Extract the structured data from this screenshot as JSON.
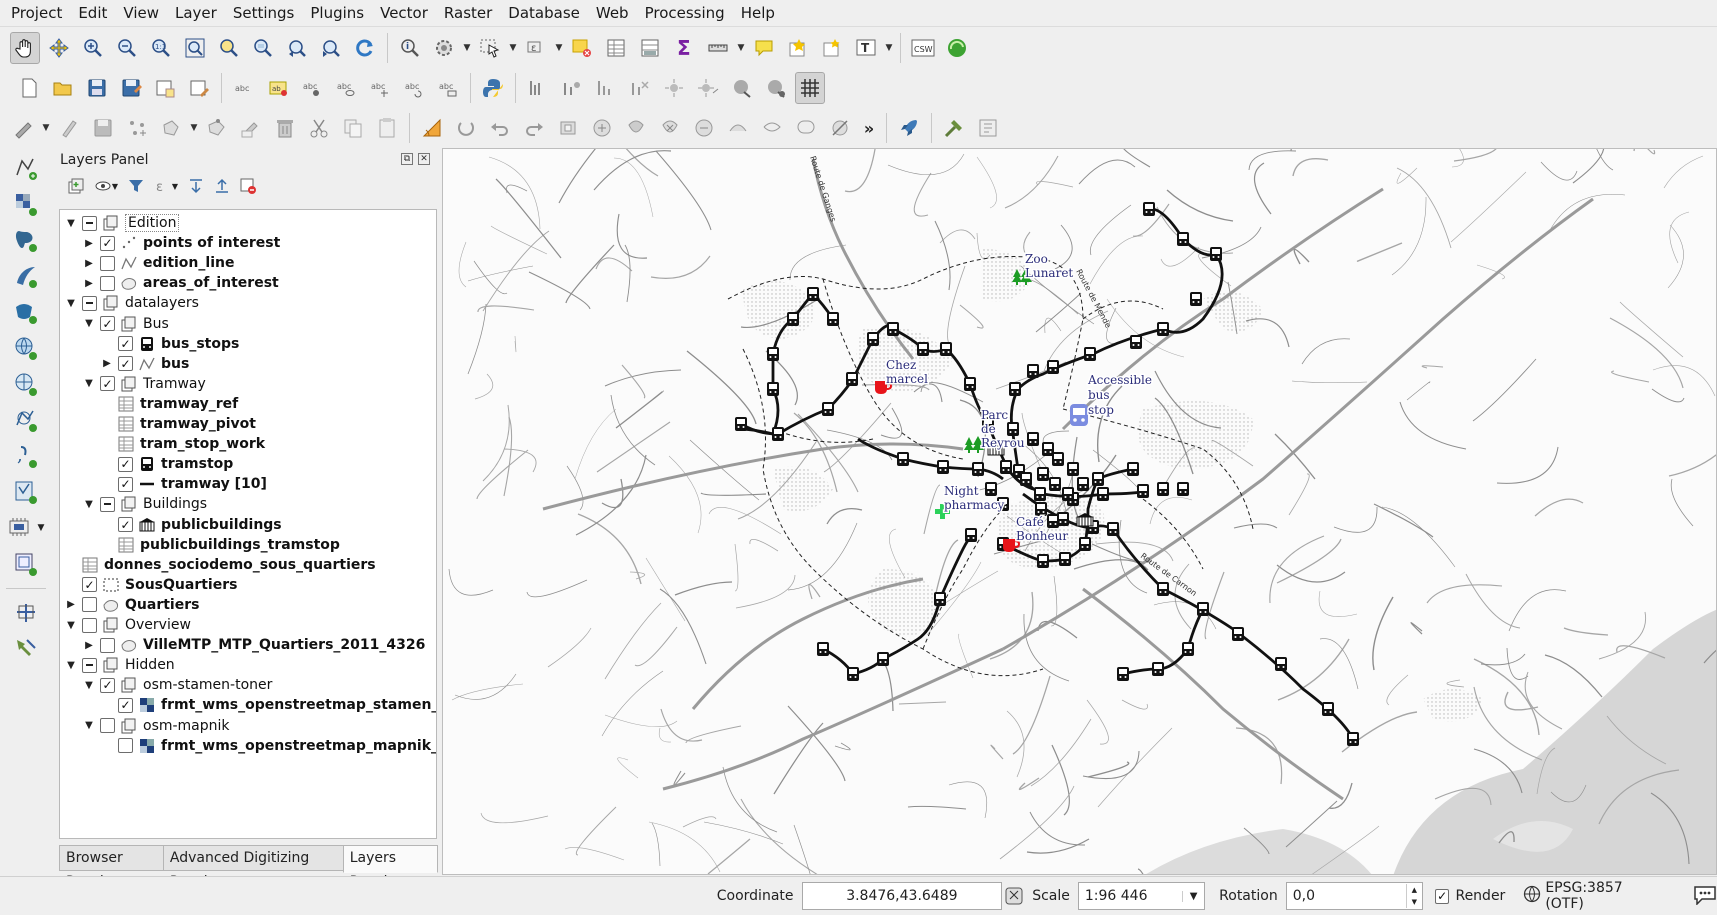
{
  "menubar": {
    "items": [
      "Project",
      "Edit",
      "View",
      "Layer",
      "Settings",
      "Plugins",
      "Vector",
      "Raster",
      "Database",
      "Web",
      "Processing",
      "Help"
    ]
  },
  "toolbar_icons": {
    "row1": [
      "pan-icon",
      "pan-to-selection-icon",
      "zoom-in-icon",
      "zoom-out-icon",
      "zoom-native-icon",
      "zoom-full-icon",
      "zoom-to-selection-icon",
      "zoom-to-layer-icon",
      "zoom-last-icon",
      "zoom-next-icon",
      "refresh-icon",
      "identify-icon",
      "action-icon",
      "select-icon",
      "deselect-icon",
      "attribute-table-icon",
      "field-calculator-icon",
      "statistics-icon",
      "measure-icon",
      "map-tips-icon",
      "new-bookmark-icon",
      "show-bookmarks-icon",
      "text-annotation-icon",
      "csw-icon",
      "qgis-cloud-icon"
    ],
    "row3_overflow": "»"
  },
  "layers_panel": {
    "title": "Layers Panel",
    "tree": [
      {
        "label": "Edition",
        "type": "group",
        "level": 0,
        "expanded": true,
        "check": "partial",
        "bold": false,
        "focus": true
      },
      {
        "label": "points of interest",
        "type": "point",
        "level": 1,
        "expanded": false,
        "check": "checked",
        "bold": true
      },
      {
        "label": "edition_line",
        "type": "line",
        "level": 1,
        "expanded": false,
        "check": "unchecked",
        "bold": true
      },
      {
        "label": "areas_of_interest",
        "type": "polygon",
        "level": 1,
        "expanded": false,
        "check": "unchecked",
        "bold": true
      },
      {
        "label": "datalayers",
        "type": "group",
        "level": 0,
        "expanded": true,
        "check": "partial",
        "bold": false
      },
      {
        "label": "Bus",
        "type": "group",
        "level": 1,
        "expanded": true,
        "check": "checked",
        "bold": false
      },
      {
        "label": "bus_stops",
        "type": "point-symbol",
        "level": 2,
        "expanded": null,
        "check": "checked",
        "bold": true
      },
      {
        "label": "bus",
        "type": "line",
        "level": 2,
        "expanded": false,
        "check": "checked",
        "bold": true
      },
      {
        "label": "Tramway",
        "type": "group",
        "level": 1,
        "expanded": true,
        "check": "checked",
        "bold": false
      },
      {
        "label": "tramway_ref",
        "type": "table",
        "level": 2,
        "expanded": null,
        "check": null,
        "bold": true
      },
      {
        "label": "tramway_pivot",
        "type": "table",
        "level": 2,
        "expanded": null,
        "check": null,
        "bold": true
      },
      {
        "label": "tram_stop_work",
        "type": "table",
        "level": 2,
        "expanded": null,
        "check": null,
        "bold": true
      },
      {
        "label": "tramstop",
        "type": "point-symbol",
        "level": 2,
        "expanded": null,
        "check": "checked",
        "bold": true
      },
      {
        "label": "tramway [10]",
        "type": "line-solid",
        "level": 2,
        "expanded": null,
        "check": "checked",
        "bold": true
      },
      {
        "label": "Buildings",
        "type": "group",
        "level": 1,
        "expanded": true,
        "check": "partial",
        "bold": false
      },
      {
        "label": "publicbuildings",
        "type": "building-symbol",
        "level": 2,
        "expanded": null,
        "check": "checked",
        "bold": true
      },
      {
        "label": "publicbuildings_tramstop",
        "type": "table",
        "level": 2,
        "expanded": null,
        "check": null,
        "bold": true
      },
      {
        "label": "donnes_sociodemo_sous_quartiers",
        "type": "table",
        "level": 0,
        "expanded": null,
        "check": null,
        "bold": true
      },
      {
        "label": "SousQuartiers",
        "type": "polygon-dashed",
        "level": 0,
        "expanded": null,
        "check": "checked",
        "bold": true
      },
      {
        "label": "Quartiers",
        "type": "polygon",
        "level": 0,
        "expanded": false,
        "check": "unchecked",
        "bold": true
      },
      {
        "label": "Overview",
        "type": "group",
        "level": 0,
        "expanded": true,
        "check": "unchecked",
        "bold": false
      },
      {
        "label": "VilleMTP_MTP_Quartiers_2011_4326",
        "type": "polygon",
        "level": 1,
        "expanded": false,
        "check": "unchecked",
        "bold": true
      },
      {
        "label": "Hidden",
        "type": "group",
        "level": 0,
        "expanded": true,
        "check": "partial",
        "bold": false
      },
      {
        "label": "osm-stamen-toner",
        "type": "group",
        "level": 1,
        "expanded": true,
        "check": "checked",
        "bold": false
      },
      {
        "label": "frmt_wms_openstreetmap_stamen_...",
        "type": "raster",
        "level": 2,
        "expanded": null,
        "check": "checked",
        "bold": true
      },
      {
        "label": "osm-mapnik",
        "type": "group",
        "level": 1,
        "expanded": true,
        "check": "unchecked",
        "bold": false
      },
      {
        "label": "frmt_wms_openstreetmap_mapnik_...",
        "type": "raster",
        "level": 2,
        "expanded": null,
        "check": "unchecked",
        "bold": true
      }
    ],
    "tabs": [
      "Browser Panel",
      "Advanced Digitizing Panel",
      "Layers Panel"
    ],
    "active_tab": "Layers Panel"
  },
  "map": {
    "labels": {
      "zoo_1": "Zoo",
      "zoo_2": "Lunaret",
      "chez_1": "Chez",
      "chez_2": "marcel",
      "bus_1": "Accessible",
      "bus_2": "bus",
      "bus_3": "stop",
      "parc_1": "Parc",
      "parc_2": "de",
      "parc_3": "Reyrou",
      "night_1": "Night",
      "night_2": "pharmacy",
      "cafe_1": "Café",
      "cafe_2": "Bonheur",
      "road_1": "Route de Ganges",
      "road_2": "Route de Mende",
      "road_3": "Route de Carnon"
    },
    "colors": {
      "tram_line": "#111111",
      "cafe": "#e8141a",
      "park": "#1c9c24",
      "pharmacy": "#2bd15a",
      "bus_stop": "#7b8ce0"
    }
  },
  "statusbar": {
    "coordinate_label": "Coordinate",
    "coordinate_value": "3.8476,43.6489",
    "scale_label": "Scale",
    "scale_value": "1:96 446",
    "rotation_label": "Rotation",
    "rotation_value": "0,0",
    "render_label": "Render",
    "render_checked": true,
    "crs": "EPSG:3857 (OTF)"
  }
}
